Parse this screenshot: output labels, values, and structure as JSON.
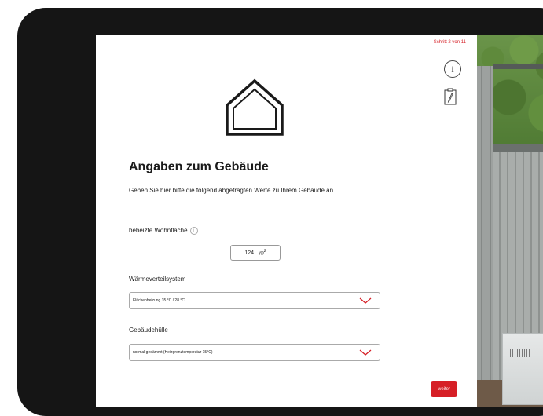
{
  "step": "Schritt 2 von 11",
  "title": "Angaben zum Gebäude",
  "description": "Geben Sie hier bitte die folgend abgefragten Werte zu Ihrem Gebäude an.",
  "living_area": {
    "label": "beheizte Wohnfläche",
    "value": "124",
    "unit": "m",
    "unit_exp": "2"
  },
  "heat_distribution": {
    "label": "Wärmeverteilsystem",
    "selected": "Flächenheizung 35 °C / 28 °C"
  },
  "building_envelope": {
    "label": "Gebäudehülle",
    "selected": "normal gedämmt (Heizgrenztemperatur 15°C)"
  },
  "next_button": "weiter",
  "colors": {
    "accent": "#d61f26"
  }
}
